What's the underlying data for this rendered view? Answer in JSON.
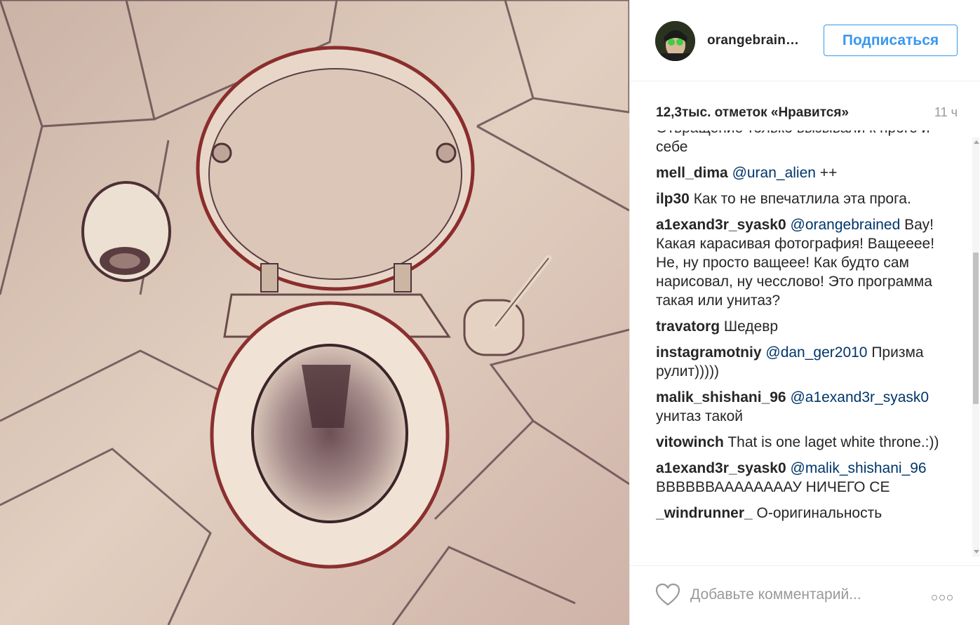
{
  "post": {
    "photo_alt": "",
    "author": {
      "username": "orangebrain…"
    },
    "follow_label": "Подписаться",
    "likes": "12,3тыс. отметок «Нравится»",
    "time": "11 ч",
    "comments": [
      {
        "user": "",
        "mention": "",
        "text": "Отвращение только вызывали к проге и себе"
      },
      {
        "user": "mell_dima",
        "mention": "@uran_alien",
        "text": " ++"
      },
      {
        "user": "ilp30",
        "mention": "",
        "text": " Как то не впечатлила эта прога."
      },
      {
        "user": "a1exand3r_syask0",
        "mention": "@orangebrained",
        "text": " Вау! Какая карасивая фотография! Ващееее! Не, ну просто ващеее! Как будто сам нарисовал, ну чесслово! Это программа такая или унитаз?"
      },
      {
        "user": "travatorg",
        "mention": "",
        "text": " Шедевр"
      },
      {
        "user": "instagramotniy",
        "mention": "@dan_ger2010",
        "text": " Призма рулит)))))"
      },
      {
        "user": "malik_shishani_96",
        "mention": "@a1exand3r_syask0",
        "text": " унитаз такой"
      },
      {
        "user": "vitowinch",
        "mention": "",
        "text": " That is one laget white throne.:))"
      },
      {
        "user": "a1exand3r_syask0",
        "mention": "@malik_shishani_96",
        "text": " ВВВВВВААААААААУ НИЧЕГО СЕ"
      },
      {
        "user": "_windrunner_",
        "mention": "",
        "text": " О-оригинальность"
      }
    ],
    "comment_placeholder": "Добавьте комментарий...",
    "colors": {
      "accent": "#3897f0",
      "mention": "#003569",
      "muted": "#999999"
    },
    "icons": [
      "heart-icon",
      "more-options-icon"
    ]
  }
}
